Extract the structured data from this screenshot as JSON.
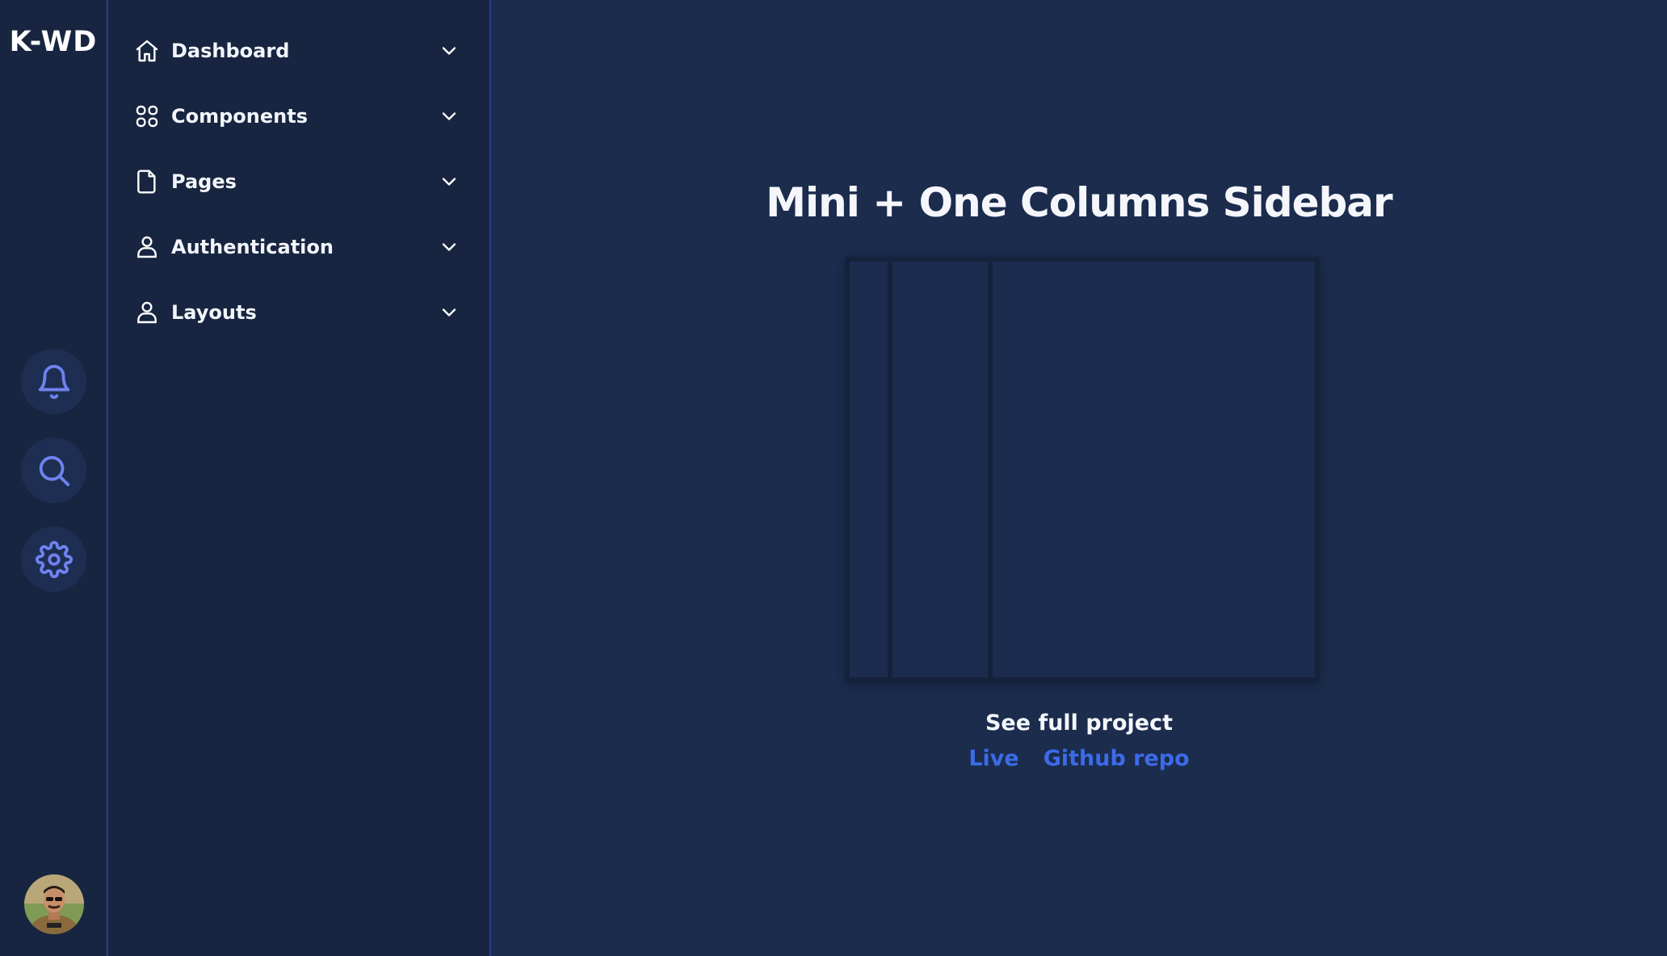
{
  "brand": {
    "logo_text": "K-WD"
  },
  "mini_sidebar": {
    "buttons": [
      {
        "icon": "bell-icon"
      },
      {
        "icon": "search-icon"
      },
      {
        "icon": "gear-icon"
      }
    ],
    "accent_color": "#6f82ef"
  },
  "nav": {
    "items": [
      {
        "label": "Dashboard",
        "icon": "home-icon"
      },
      {
        "label": "Components",
        "icon": "grid-icon"
      },
      {
        "label": "Pages",
        "icon": "file-icon"
      },
      {
        "label": "Authentication",
        "icon": "user-icon"
      },
      {
        "label": "Layouts",
        "icon": "user-icon"
      }
    ]
  },
  "main": {
    "title": "Mini + One Columns Sidebar",
    "see_full_project": "See full project",
    "links": {
      "live": "Live",
      "github": "Github repo"
    }
  },
  "colors": {
    "background": "#1b2c4d",
    "sidebar": "#172540",
    "link": "#3c6be8",
    "border_accent": "#2c3f8c"
  }
}
